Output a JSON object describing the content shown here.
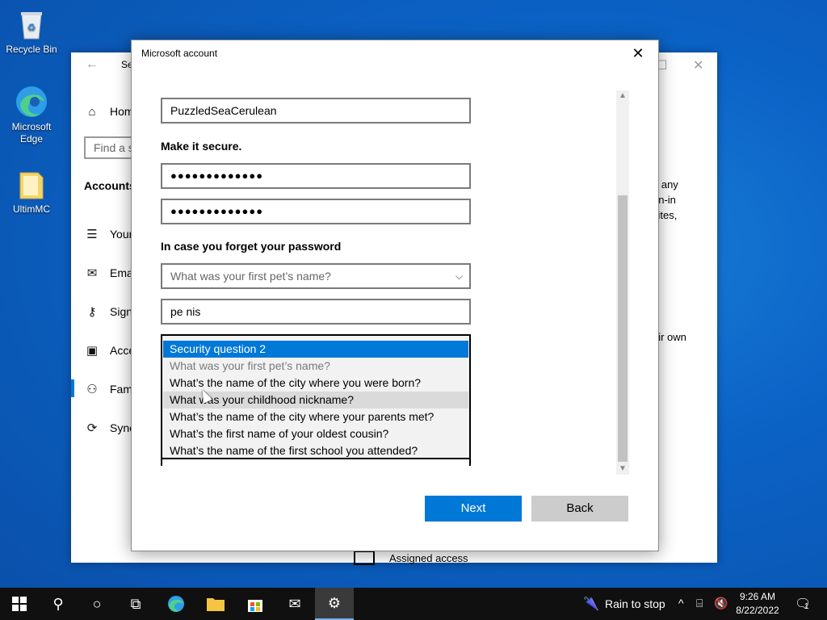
{
  "desktop": {
    "icons": [
      {
        "label": "Recycle Bin"
      },
      {
        "label": "Microsoft Edge"
      },
      {
        "label": "UltimMC"
      }
    ]
  },
  "settings_window": {
    "title_partial": "Se",
    "nav": {
      "home": "Hom",
      "search_placeholder": "Find a s",
      "section": "Accounts",
      "items": [
        "Your",
        "Ema",
        "Sign",
        "Acce",
        "Fam",
        "Sync"
      ]
    },
    "right_text": [
      "d any",
      "gn-in",
      "sites,",
      "eir own"
    ],
    "assigned_access": "Assigned access"
  },
  "dialog": {
    "title": "Microsoft account",
    "username_value": "PuzzledSeaCerulean",
    "secure_heading": "Make it secure.",
    "password_mask": "●●●●●●●●●●●●●",
    "confirm_mask": "●●●●●●●●●●●●●",
    "forgot_heading": "In case you forget your password",
    "question1_value": "What was your first pet’s name?",
    "answer1_value": "pe nis",
    "question2_options": [
      "Security question 2",
      "What was your first pet’s name?",
      "What’s the name of the city where you were born?",
      "What was your childhood nickname?",
      "What’s the name of the city where your parents met?",
      "What’s the first name of your oldest cousin?",
      "What’s the name of the first school you attended?"
    ],
    "next_label": "Next",
    "back_label": "Back"
  },
  "taskbar": {
    "weather": "Rain to stop",
    "time": "9:26 AM",
    "date": "8/22/2022",
    "notification_count": "1"
  }
}
